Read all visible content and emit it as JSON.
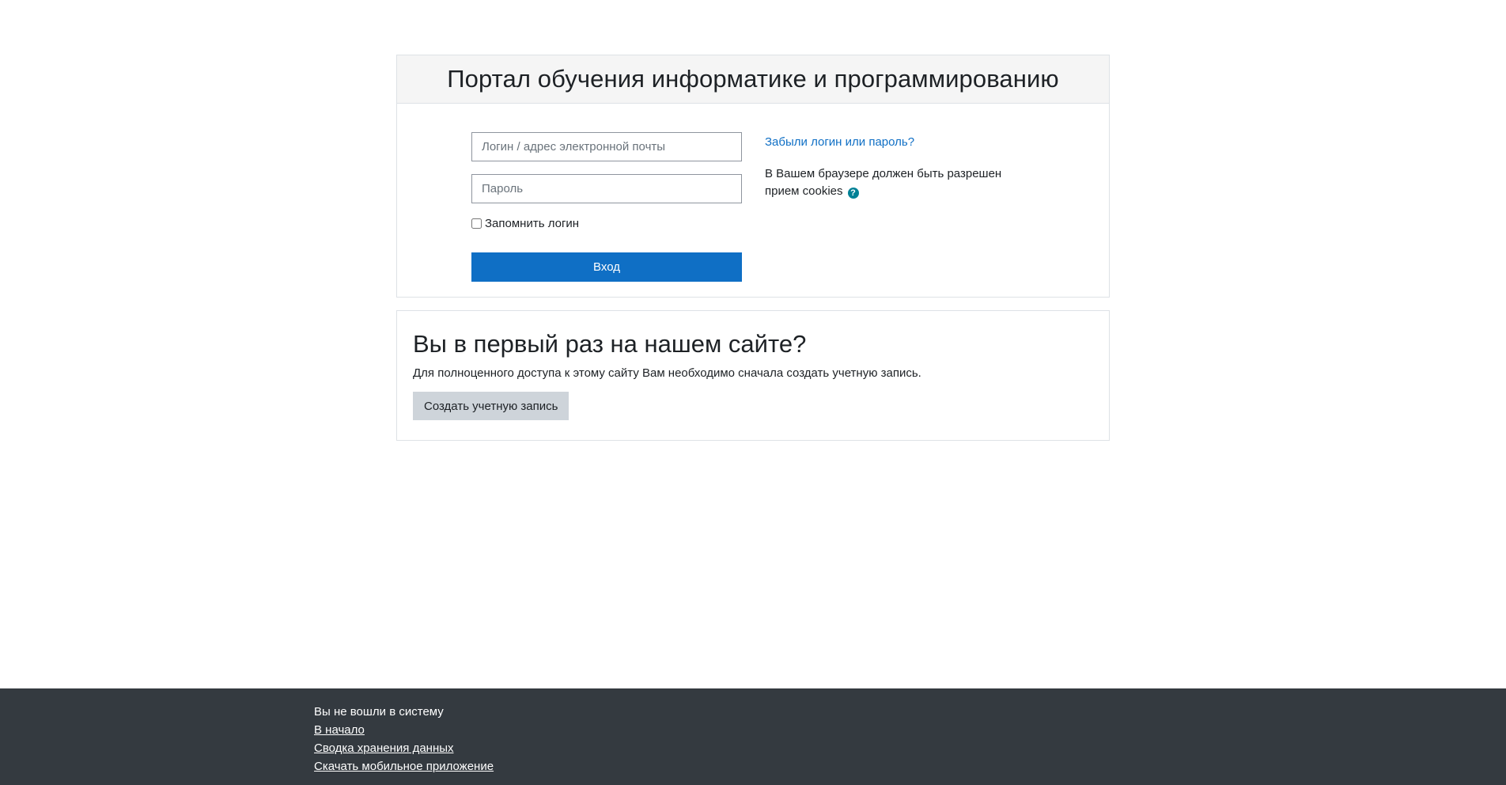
{
  "colors": {
    "primary": "#0f6fc5",
    "secondary_button": "#ced4da",
    "footer_bg": "#343a40",
    "help_icon": "#008196",
    "header_bg": "#f5f5f5"
  },
  "login": {
    "title": "Портал обучения информатике и программированию",
    "username_placeholder": "Логин / адрес электронной почты",
    "password_placeholder": "Пароль",
    "remember_label": "Запомнить логин",
    "submit_label": "Вход",
    "forgot_link": "Забыли логин или пароль?",
    "cookies_note": "В Вашем браузере должен быть разрешен прием cookies",
    "help_icon": "question-circle-icon"
  },
  "signup": {
    "title": "Вы в первый раз на нашем сайте?",
    "description": "Для полноценного доступа к этому сайту Вам необходимо сначала создать учетную запись.",
    "button_label": "Создать учетную запись"
  },
  "footer": {
    "status": "Вы не вошли в систему",
    "links": [
      "В начало",
      "Сводка хранения данных",
      "Скачать мобильное приложение"
    ]
  }
}
